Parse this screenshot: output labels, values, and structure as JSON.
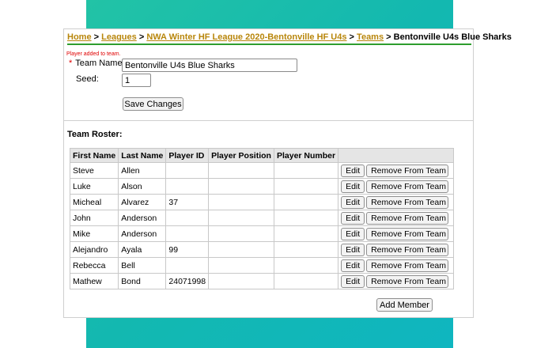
{
  "breadcrumb": {
    "home": "Home",
    "leagues": "Leagues",
    "league": "NWA Winter HF League 2020-Bentonville HF U4s",
    "teams": "Teams",
    "current": "Bentonville U4s Blue Sharks",
    "separator": ">"
  },
  "flash_message": "Player added to team.",
  "form": {
    "required_marker": "*",
    "team_name_label": "Team Name:",
    "team_name_value": "Bentonville U4s Blue Sharks",
    "seed_label": "Seed:",
    "seed_value": "1",
    "save_label": "Save Changes"
  },
  "roster": {
    "title": "Team Roster:",
    "columns": [
      "First Name",
      "Last Name",
      "Player ID",
      "Player Position",
      "Player Number"
    ],
    "rows": [
      {
        "first": "Steve",
        "last": "Allen",
        "id": "",
        "position": "",
        "number": ""
      },
      {
        "first": "Luke",
        "last": "Alson",
        "id": "",
        "position": "",
        "number": ""
      },
      {
        "first": "Micheal",
        "last": "Alvarez",
        "id": "37",
        "position": "",
        "number": ""
      },
      {
        "first": "John",
        "last": "Anderson",
        "id": "",
        "position": "",
        "number": ""
      },
      {
        "first": "Mike",
        "last": "Anderson",
        "id": "",
        "position": "",
        "number": ""
      },
      {
        "first": "Alejandro",
        "last": "Ayala",
        "id": "99",
        "position": "",
        "number": ""
      },
      {
        "first": "Rebecca",
        "last": "Bell",
        "id": "",
        "position": "",
        "number": ""
      },
      {
        "first": "Mathew",
        "last": "Bond",
        "id": "24071998",
        "position": "",
        "number": ""
      }
    ],
    "edit_label": "Edit",
    "remove_label": "Remove From Team",
    "add_member_label": "Add Member"
  },
  "colors": {
    "link": "#b8860b",
    "breadcrumb_rule": "#2e9d2e",
    "flash": "#e00000",
    "band": "#13b8b0"
  }
}
